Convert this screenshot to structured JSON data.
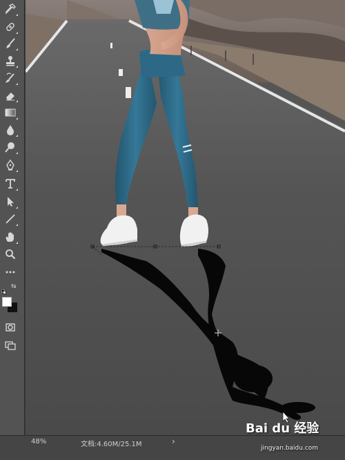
{
  "statusbar": {
    "zoom": "48%",
    "doc_info": "文档:4.60M/25.1M",
    "arrow": "›"
  },
  "watermark": {
    "brand": "Bai du 经验",
    "sub": "jingyan.baidu.com"
  },
  "toolbar": {
    "tools": [
      "eyedropper-icon",
      "healing-brush-icon",
      "brush-icon",
      "clone-stamp-icon",
      "history-brush-icon",
      "eraser-icon",
      "gradient-icon",
      "blur-icon",
      "dodge-icon",
      "pen-icon",
      "type-icon",
      "path-selection-icon",
      "line-icon",
      "hand-icon",
      "zoom-icon",
      "more-tools-icon"
    ],
    "foreground_color": "#ffffff",
    "background_color": "#111111"
  },
  "canvas": {
    "description_colors": {
      "road": "#4a4a4a",
      "shadow": "#050505",
      "leggings": "#2f6b8a",
      "sky_hills": "#6b5f58"
    }
  }
}
